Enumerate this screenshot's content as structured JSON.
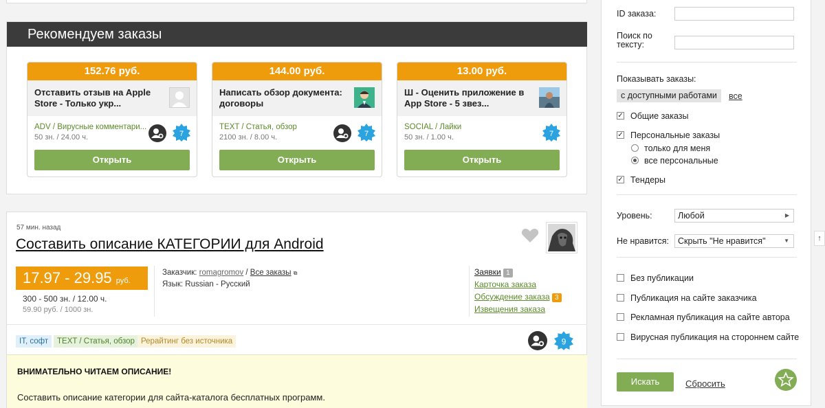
{
  "recommended": {
    "heading": "Рекомендуем заказы",
    "open_label": "Открыть",
    "cards": [
      {
        "price": "152.76 руб.",
        "title": "Отставить отзыв на Apple Store - Только укр...",
        "category": "ADV / Вирусные комментари...",
        "meta": "50 зн. / 24.00 ч.",
        "badge": "7"
      },
      {
        "price": "144.00 руб.",
        "title": "Написать обзор документа: договоры",
        "category": "TEXT / Статья, обзор",
        "meta": "2100 зн. / 8.00 ч.",
        "badge": "7"
      },
      {
        "price": "13.00 руб.",
        "title": "Ш - Оценить приложение в App Store - 5 звез...",
        "category": "SOCIAL / Лайки",
        "meta": "50 зн. / 1.00 ч.",
        "badge": "7"
      }
    ]
  },
  "order": {
    "time": "57 мин. назад",
    "title": "Составить описание КАТЕГОРИИ для Android",
    "price": "17.97 - 29.95",
    "price_unit": "руб.",
    "volume": "300 - 500 зн. / 12.00 ч.",
    "rate": "59.90 руб. / 1000 зн.",
    "client_label": "Заказчик:",
    "client_name": "romagromov",
    "all_orders": "Все заказы",
    "language": "Язык: Russian - Русский",
    "links": {
      "requests": "Заявки",
      "requests_count": "1",
      "card": "Карточка заказа",
      "discussion": "Обсуждение заказа",
      "discussion_count": "3",
      "notifications": "Извещения заказа"
    },
    "tags": [
      "IT, софт",
      "TEXT / Статья, обзор",
      "Рерайтинг без источника"
    ],
    "badge": "9",
    "desc_heading": "ВНИМАТЕЛЬНО ЧИТАЕМ ОПИСАНИЕ!",
    "desc_text": "Составить описание категории для сайта-каталога бесплатных программ."
  },
  "sidebar": {
    "id_label": "ID заказа:",
    "search_label_1": "Поиск по",
    "search_label_2": "тексту:",
    "show_label": "Показывать заказы:",
    "filter_available": "с доступными работами",
    "filter_all": "все",
    "general": "Общие заказы",
    "personal": "Персональные заказы",
    "only_me": "только для меня",
    "all_personal": "все персональные",
    "tenders": "Тендеры",
    "level_label": "Уровень:",
    "level_value": "Любой",
    "dislike_label": "Не нравится:",
    "dislike_value": "Скрыть \"Не нравится\"",
    "no_pub": "Без публикации",
    "pub_client": "Публикация на сайте заказчика",
    "pub_ad": "Рекламная публикация на сайте автора",
    "pub_viral": "Вирусная публикация на стороннем сайте",
    "search_btn": "Искать",
    "reset": "Сбросить"
  },
  "colors": {
    "accent_orange": "#ee9b0c",
    "button_green": "#82ad55",
    "badge_blue": "#2ba3e0",
    "dark_header": "#3b3b3b"
  }
}
